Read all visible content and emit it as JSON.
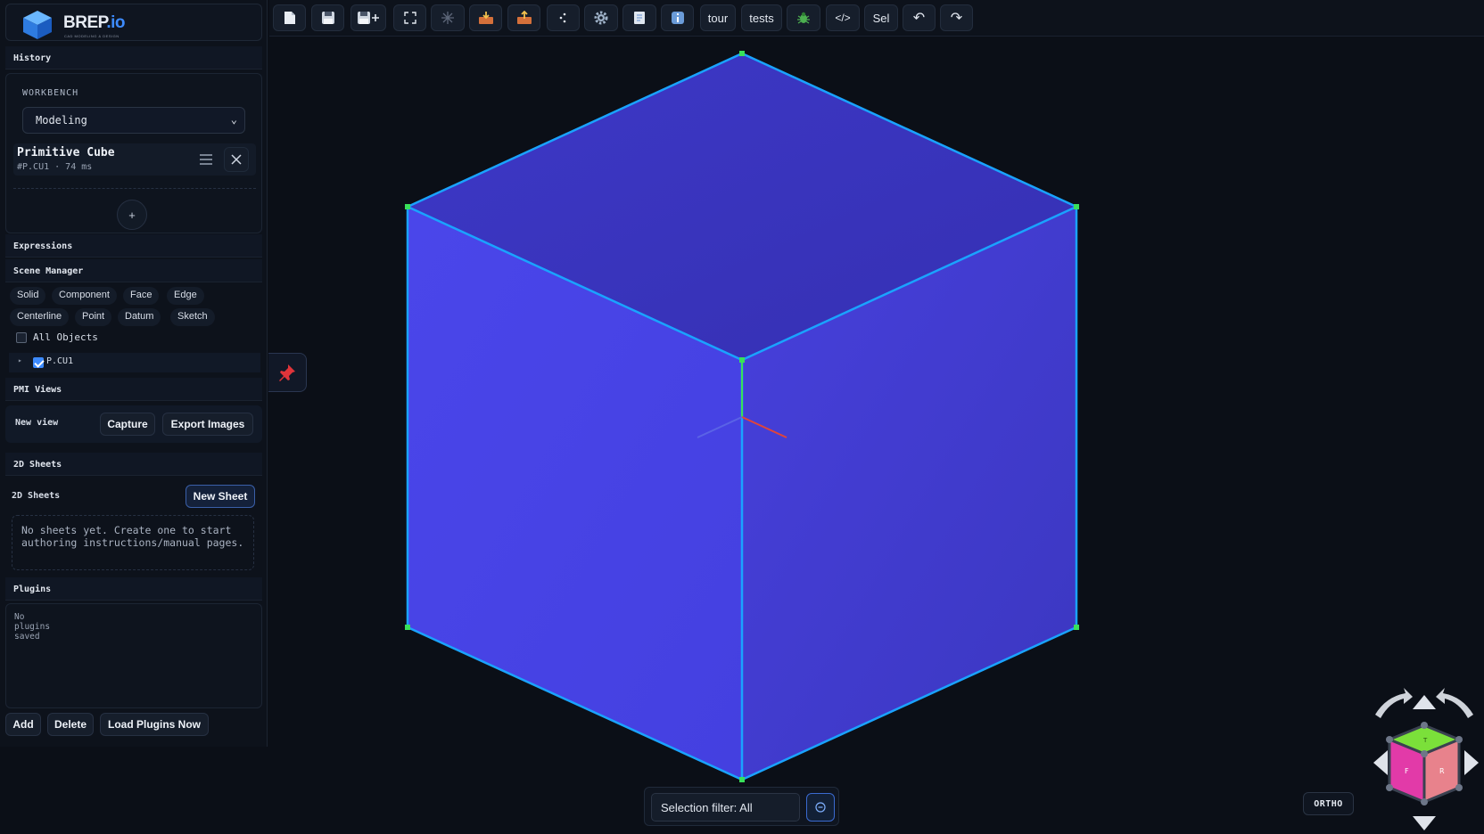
{
  "app": {
    "logo_text": "BREP",
    "logo_suffix": ".io",
    "logo_tagline": "CAD MODELING & DESIGN"
  },
  "sidebar": {
    "history": {
      "title": "History"
    },
    "workbench": {
      "label": "WORKBENCH",
      "selected": "Modeling"
    },
    "feature": {
      "title": "Primitive Cube",
      "meta": "#P.CU1 · 74 ms"
    },
    "add_symbol": "+",
    "expressions": {
      "title": "Expressions"
    },
    "scene_manager": {
      "title": "Scene Manager",
      "filters": [
        "Solid",
        "Component",
        "Face",
        "Edge",
        "Centerline",
        "Point",
        "Datum",
        "Sketch"
      ],
      "all_objects": "All Objects",
      "tree_item": "P.CU1"
    },
    "pmi_views": {
      "title": "PMI Views",
      "new_view": "New view",
      "capture": "Capture",
      "export": "Export Images"
    },
    "sheets": {
      "title": "2D Sheets",
      "subtitle": "2D Sheets",
      "new_sheet": "New Sheet",
      "empty": "No sheets yet. Create one to start authoring instructions/manual pages."
    },
    "plugins": {
      "title": "Plugins",
      "empty": "No plugins saved",
      "add": "Add",
      "delete": "Delete",
      "load": "Load Plugins Now"
    }
  },
  "toolbar": {
    "icons": [
      "new-file-icon",
      "save-icon",
      "save-as-icon",
      "fit-view-icon",
      "wireframe-icon",
      "import-icon",
      "export-icon",
      "points-icon",
      "settings-icon",
      "scripts-icon",
      "info-icon"
    ],
    "tour": "tour",
    "tests": "tests",
    "code": "</>",
    "sel": "Sel",
    "undo": "↶",
    "redo": "↷"
  },
  "viewport": {
    "selection_filter": "Selection filter: All",
    "projection": "ORTHO",
    "view_cube": {
      "top": "T",
      "front": "F",
      "right": "R"
    },
    "colors": {
      "face": "#4742e6",
      "edge": "#1aa3ff",
      "vertex": "#39e05a",
      "accent": "#3d8bff"
    }
  }
}
